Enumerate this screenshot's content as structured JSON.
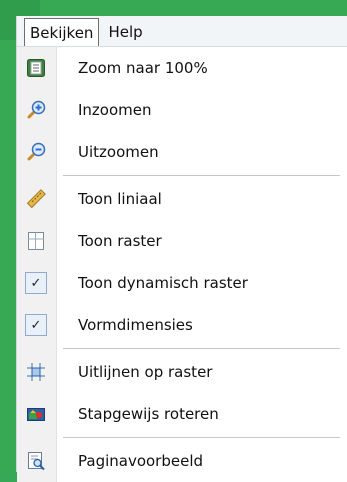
{
  "menubar": {
    "items": [
      {
        "label": "Bekijken",
        "open": true
      },
      {
        "label": "Help",
        "open": false
      }
    ]
  },
  "menu": {
    "items": [
      {
        "label": "Zoom naar 100%",
        "icon": "zoom-100-icon"
      },
      {
        "label": "Inzoomen",
        "icon": "zoom-in-icon"
      },
      {
        "label": "Uitzoomen",
        "icon": "zoom-out-icon"
      },
      {
        "separator": true
      },
      {
        "label": "Toon liniaal",
        "icon": "ruler-icon"
      },
      {
        "label": "Toon raster",
        "icon": "grid-icon"
      },
      {
        "label": "Toon dynamisch raster",
        "icon": "checkmark-icon",
        "checked": true
      },
      {
        "label": "Vormdimensies",
        "icon": "checkmark-icon",
        "checked": true
      },
      {
        "separator": true
      },
      {
        "label": "Uitlijnen op raster",
        "icon": "snap-to-grid-icon"
      },
      {
        "label": "Stapgewijs roteren",
        "icon": "rotate-step-icon"
      },
      {
        "separator": true
      },
      {
        "label": "Paginavoorbeeld",
        "icon": "page-preview-icon"
      }
    ]
  },
  "colors": {
    "background": "#37a955",
    "menu_gutter": "#f1f1f1",
    "menubar": "#f2f5f8"
  }
}
